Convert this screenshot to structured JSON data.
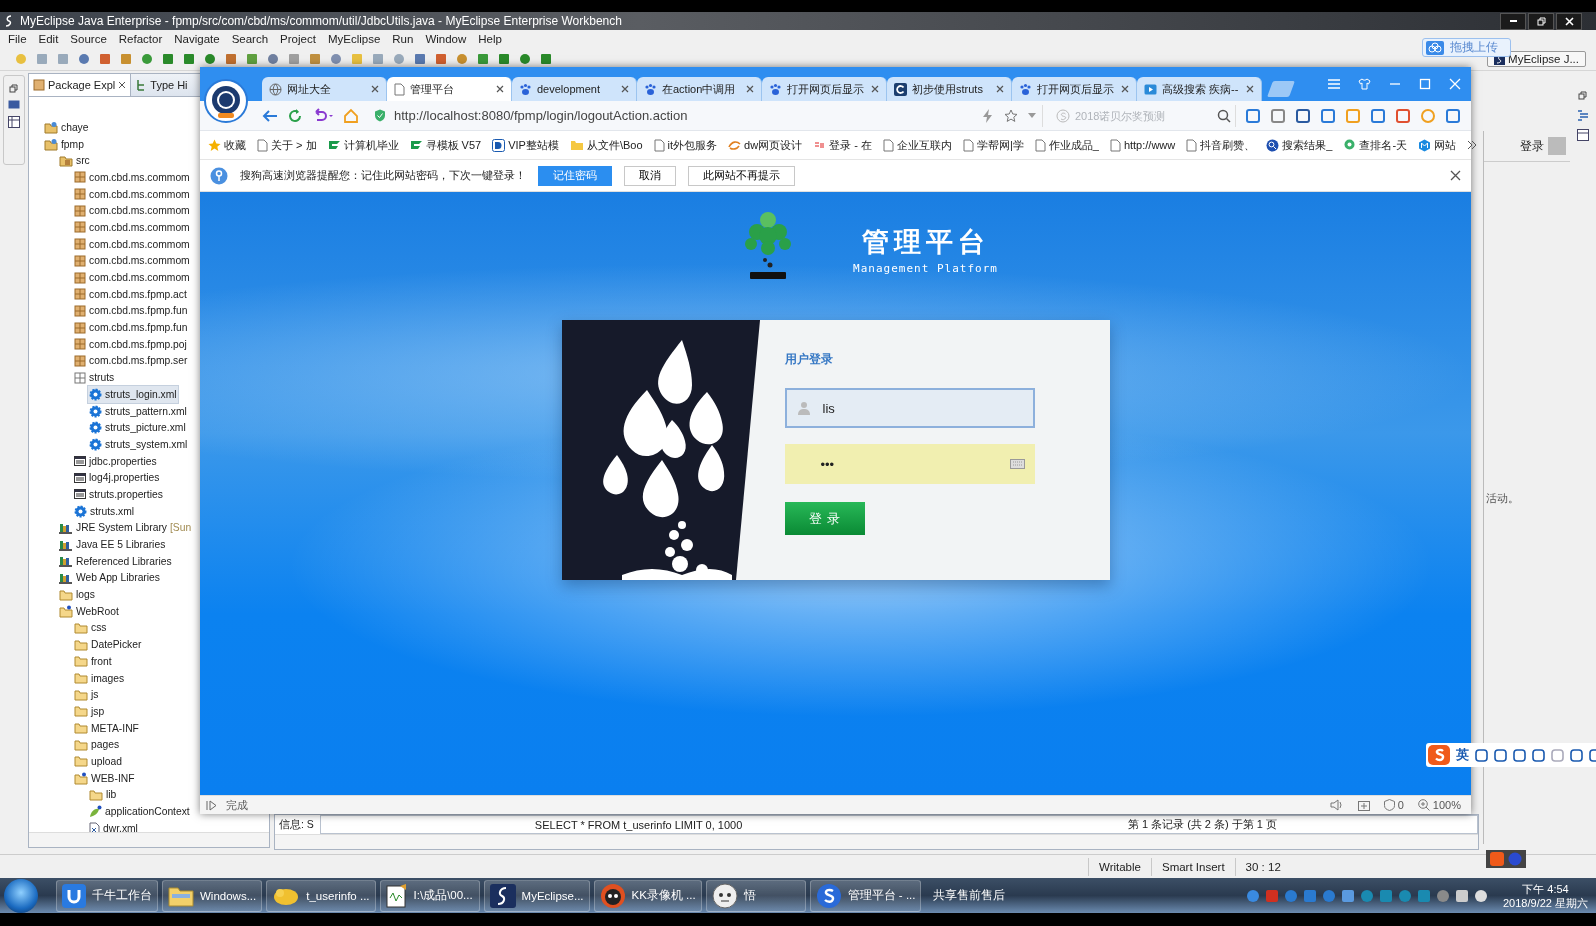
{
  "ide": {
    "title": "MyEclipse Java Enterprise - fpmp/src/com/cbd/ms/commom/util/JdbcUtils.java - MyEclipse Enterprise Workbench",
    "menu": [
      "File",
      "Edit",
      "Source",
      "Refactor",
      "Navigate",
      "Search",
      "Project",
      "MyEclipse",
      "Run",
      "Window",
      "Help"
    ],
    "upload_button": "拖拽上传",
    "perspective": "MyEclipse J...",
    "explorer": {
      "tabs": [
        {
          "label": "Package Expl",
          "selected": true
        },
        {
          "label": "Type Hi",
          "selected": false
        }
      ],
      "tree": [
        {
          "label": "chaye",
          "kind": "project",
          "selected": false
        },
        {
          "label": "fpmp",
          "kind": "project",
          "selected": false,
          "children": [
            {
              "label": "src",
              "kind": "source",
              "selected": false,
              "children": [
                {
                  "label": "com.cbd.ms.commom",
                  "kind": "package",
                  "selected": false
                },
                {
                  "label": "com.cbd.ms.commom",
                  "kind": "package",
                  "selected": false
                },
                {
                  "label": "com.cbd.ms.commom",
                  "kind": "package",
                  "selected": false
                },
                {
                  "label": "com.cbd.ms.commom",
                  "kind": "package",
                  "selected": false
                },
                {
                  "label": "com.cbd.ms.commom",
                  "kind": "package",
                  "selected": false
                },
                {
                  "label": "com.cbd.ms.commom",
                  "kind": "package",
                  "selected": false
                },
                {
                  "label": "com.cbd.ms.commom",
                  "kind": "package",
                  "selected": false
                },
                {
                  "label": "com.cbd.ms.fpmp.act",
                  "kind": "package",
                  "selected": false
                },
                {
                  "label": "com.cbd.ms.fpmp.fun",
                  "kind": "package",
                  "selected": false
                },
                {
                  "label": "com.cbd.ms.fpmp.fun",
                  "kind": "package",
                  "selected": false
                },
                {
                  "label": "com.cbd.ms.fpmp.poj",
                  "kind": "package",
                  "selected": false
                },
                {
                  "label": "com.cbd.ms.fpmp.ser",
                  "kind": "package",
                  "selected": false
                },
                {
                  "label": "struts",
                  "kind": "plain-package",
                  "selected": false,
                  "children": [
                    {
                      "label": "struts_login.xml",
                      "kind": "xml",
                      "selected": true
                    },
                    {
                      "label": "struts_pattern.xml",
                      "kind": "xml",
                      "selected": false
                    },
                    {
                      "label": "struts_picture.xml",
                      "kind": "xml",
                      "selected": false
                    },
                    {
                      "label": "struts_system.xml",
                      "kind": "xml",
                      "selected": false
                    }
                  ]
                },
                {
                  "label": "jdbc.properties",
                  "kind": "properties",
                  "selected": false
                },
                {
                  "label": "log4j.properties",
                  "kind": "properties",
                  "selected": false
                },
                {
                  "label": "struts.properties",
                  "kind": "properties",
                  "selected": false
                },
                {
                  "label": "struts.xml",
                  "kind": "xml",
                  "selected": false
                }
              ]
            },
            {
              "label": "JRE System Library",
              "note": "[Sun",
              "kind": "library",
              "selected": false
            },
            {
              "label": "Java EE 5 Libraries",
              "kind": "library",
              "selected": false
            },
            {
              "label": "Referenced Libraries",
              "kind": "library",
              "selected": false
            },
            {
              "label": "Web App Libraries",
              "kind": "library",
              "selected": false
            },
            {
              "label": "logs",
              "kind": "folder",
              "selected": false
            },
            {
              "label": "WebRoot",
              "kind": "web-folder",
              "selected": false,
              "children": [
                {
                  "label": "css",
                  "kind": "folder",
                  "selected": false
                },
                {
                  "label": "DatePicker",
                  "kind": "folder",
                  "selected": false
                },
                {
                  "label": "front",
                  "kind": "folder",
                  "selected": false
                },
                {
                  "label": "images",
                  "kind": "folder",
                  "selected": false
                },
                {
                  "label": "js",
                  "kind": "folder",
                  "selected": false
                },
                {
                  "label": "jsp",
                  "kind": "folder",
                  "selected": false
                },
                {
                  "label": "META-INF",
                  "kind": "folder",
                  "selected": false
                },
                {
                  "label": "pages",
                  "kind": "folder",
                  "selected": false
                },
                {
                  "label": "upload",
                  "kind": "folder",
                  "selected": false
                },
                {
                  "label": "WEB-INF",
                  "kind": "web-folder",
                  "selected": false,
                  "children": [
                    {
                      "label": "lib",
                      "kind": "folder",
                      "selected": false
                    },
                    {
                      "label": "applicationContext",
                      "kind": "spring",
                      "selected": false
                    },
                    {
                      "label": "dwr.xml",
                      "kind": "file-xml",
                      "selected": false
                    }
                  ]
                }
              ]
            }
          ]
        }
      ]
    },
    "console": {
      "prefix": "信息: S",
      "query": "SELECT * FROM  t_userinfo  LIMIT 0, 1000",
      "paging": "第 1 条记录 (共 2 条) 于第 1 页"
    },
    "side_panel": {
      "login": "登录",
      "note": "活动。"
    },
    "status_bar": [
      "Writable",
      "Smart Insert",
      "30 : 12"
    ]
  },
  "browser": {
    "tabs": [
      {
        "label": "网址大全",
        "kind": "globe",
        "selected": false
      },
      {
        "label": "管理平台",
        "kind": "page",
        "selected": true
      },
      {
        "label": "development",
        "kind": "paw",
        "selected": false
      },
      {
        "label": "在action中调用",
        "kind": "paw",
        "selected": false
      },
      {
        "label": "打开网页后显示",
        "kind": "paw",
        "selected": false
      },
      {
        "label": "初步使用struts",
        "kind": "c",
        "selected": false
      },
      {
        "label": "打开网页后显示",
        "kind": "paw",
        "selected": false
      },
      {
        "label": "高级搜索 疾病--",
        "kind": "video",
        "selected": false
      }
    ],
    "url": "http://localhost:8080/fpmp/login/logoutAction.action",
    "search": {
      "placeholder": "2018诺贝尔奖预测"
    },
    "bookmarks": [
      {
        "label": "收藏",
        "kind": "star"
      },
      {
        "label": "关于 > 加",
        "kind": "page"
      },
      {
        "label": "计算机毕业",
        "kind": "leaf"
      },
      {
        "label": "寻模板 V57",
        "kind": "leaf"
      },
      {
        "label": "VIP整站模",
        "kind": "vip"
      },
      {
        "label": "从文件\\Boo",
        "kind": "folder"
      },
      {
        "label": "it外包服务",
        "kind": "page"
      },
      {
        "label": "dw网页设计",
        "kind": "dw"
      },
      {
        "label": "登录 - 在",
        "kind": "order"
      },
      {
        "label": "企业互联内",
        "kind": "page"
      },
      {
        "label": "学帮网|学",
        "kind": "page"
      },
      {
        "label": "作业成品_",
        "kind": "page"
      },
      {
        "label": "http://www",
        "kind": "page"
      },
      {
        "label": "抖音刷赞、",
        "kind": "page"
      },
      {
        "label": "搜索结果_",
        "kind": "search"
      },
      {
        "label": "查排名-天",
        "kind": "pin"
      },
      {
        "label": "网站",
        "kind": "m"
      }
    ],
    "notice": {
      "text": "搜狗高速浏览器提醒您：记住此网站密码，下次一键登录！",
      "buttons": [
        {
          "label": "记住密码",
          "primary": true
        },
        {
          "label": "取消",
          "primary": false
        },
        {
          "label": "此网站不再提示",
          "primary": false
        }
      ]
    },
    "page": {
      "title": "管理平台",
      "subtitle": "Management Platform",
      "form_title": "用户登录",
      "username": "lis",
      "password": "•••",
      "submit": "登 录"
    },
    "status": {
      "text": "完成",
      "blocked": "0",
      "zoom": "100%"
    }
  },
  "ime": {
    "mode": "英"
  },
  "taskbar": {
    "items": [
      {
        "label": "千牛工作台",
        "kind": "qianniu"
      },
      {
        "label": "Windows...",
        "kind": "explorer"
      },
      {
        "label": "t_userinfo ...",
        "kind": "db"
      },
      {
        "label": "I:\\成品\\00...",
        "kind": "notepad"
      },
      {
        "label": "MyEclipse...",
        "kind": "eclipse"
      },
      {
        "label": "KK录像机 ...",
        "kind": "kk"
      },
      {
        "label": "悟",
        "kind": "wu"
      },
      {
        "label": "管理平台 - ...",
        "kind": "sogou"
      }
    ],
    "toolbar_label": "共享售前售后",
    "time": "下午 4:54",
    "date": "2018/9/22 星期六"
  }
}
